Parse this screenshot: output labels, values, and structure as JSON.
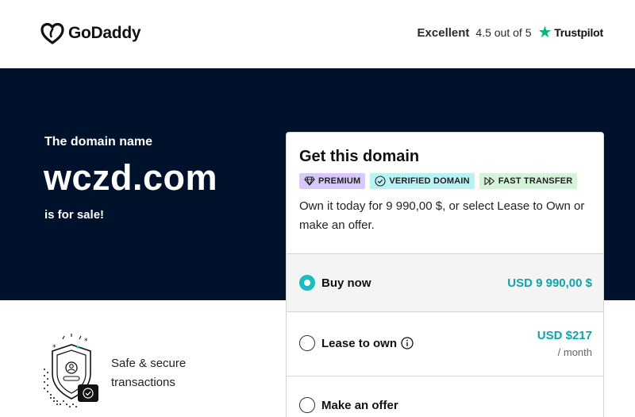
{
  "header": {
    "logo_text": "GoDaddy",
    "rating_word": "Excellent",
    "rating_score": "4.5 out of 5",
    "trustpilot_label": "Trustpilot"
  },
  "hero": {
    "pre_text": "The domain name",
    "domain": "wczd.com",
    "post_text": "is for sale!"
  },
  "feature": {
    "text": "Safe & secure transactions",
    "icon": "shield-secure-icon"
  },
  "card": {
    "title": "Get this domain",
    "badges": [
      {
        "label": "PREMIUM",
        "icon": "diamond-icon"
      },
      {
        "label": "VERIFIED DOMAIN",
        "icon": "check-circle-icon"
      },
      {
        "label": "FAST TRANSFER",
        "icon": "fast-forward-icon"
      }
    ],
    "description": "Own it today for 9 990,00 $, or select Lease to Own or make an offer.",
    "options": {
      "buy": {
        "label": "Buy now",
        "price": "USD 9 990,00 $",
        "selected": true
      },
      "lease": {
        "label": "Lease to own",
        "price": "USD $217",
        "period": "/ month",
        "selected": false
      },
      "offer": {
        "label": "Make an offer",
        "selected": false
      }
    }
  },
  "colors": {
    "hero_bg": "#00112c",
    "accent_teal": "#1bbdc1",
    "price_teal": "#11a3a8",
    "trustpilot_green": "#00b67a",
    "badge_premium": "#d7c8fb",
    "badge_verified": "#b8f2f5",
    "badge_fast": "#d5f3d8"
  }
}
